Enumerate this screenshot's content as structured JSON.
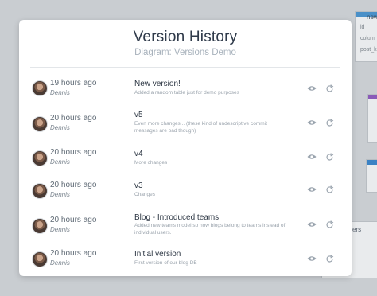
{
  "modal": {
    "title": "Version History",
    "subtitle": "Diagram: Versions Demo"
  },
  "background": {
    "table_title": "new",
    "fields": [
      "id",
      "colum",
      "post_k"
    ],
    "bottom_label": "sers"
  },
  "versions": [
    {
      "time": "19 hours ago",
      "author": "Dennis",
      "name": "New version!",
      "description": "Added a random table just for demo purposes"
    },
    {
      "time": "20 hours ago",
      "author": "Dennis",
      "name": "v5",
      "description": "Even more changes... (these kind of undescriptive commit messages are bad though)"
    },
    {
      "time": "20 hours ago",
      "author": "Dennis",
      "name": "v4",
      "description": "More changes"
    },
    {
      "time": "20 hours ago",
      "author": "Dennis",
      "name": "v3",
      "description": "Changes"
    },
    {
      "time": "20 hours ago",
      "author": "Dennis",
      "name": "Blog - Introduced teams",
      "description": "Added new teams model so now blogs belong to teams instead of individual users."
    },
    {
      "time": "20 hours ago",
      "author": "Dennis",
      "name": "Initial version",
      "description": "First version of our blog DB"
    }
  ],
  "icons": {
    "view": "eye-icon",
    "restore": "restore-icon"
  },
  "colors": {
    "icon": "#9aa4ae",
    "title": "#2f3a4a"
  }
}
